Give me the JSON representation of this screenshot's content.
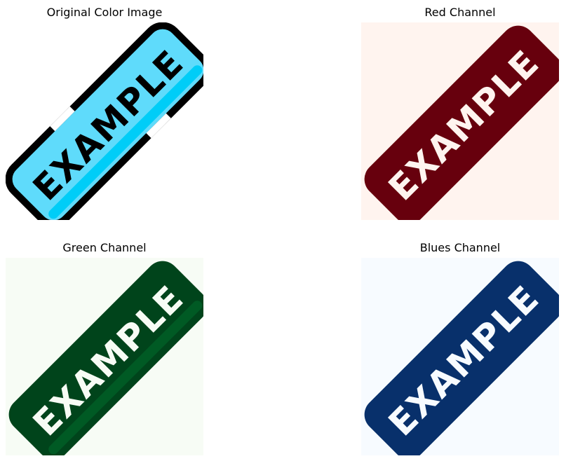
{
  "panels": {
    "original": {
      "title": "Original Color Image",
      "background": "#ffffff",
      "stamp_fill": "#5fdbfb",
      "stamp_shade": "#00cdf7",
      "outline": "#000000",
      "text_color": "#000000"
    },
    "red": {
      "title": "Red Channel",
      "background": "#fff4ef",
      "stamp_fill": "#67000d",
      "stamp_shade": "#67000d",
      "text_color": "#fff4ef"
    },
    "green": {
      "title": "Green Channel",
      "background": "#f7fcf5",
      "stamp_fill": "#00441b",
      "stamp_shade": "#005a24",
      "text_color": "#f7fcf5"
    },
    "blue": {
      "title": "Blues Channel",
      "background": "#f7fbff",
      "stamp_fill": "#08306b",
      "stamp_shade": "#08306b",
      "text_color": "#f7fbff"
    }
  },
  "stamp_text": "EXAMPLE"
}
